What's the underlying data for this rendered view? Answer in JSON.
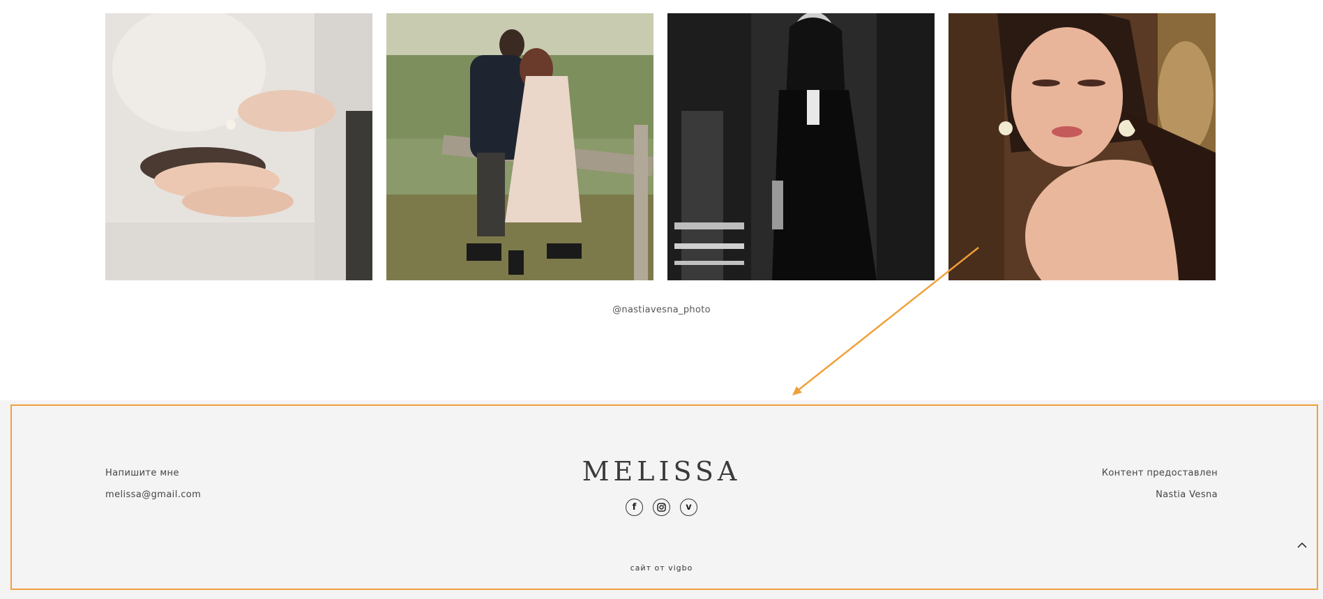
{
  "instagram": {
    "handle": "@nastiavesna_photo",
    "photos": [
      {
        "alt": "hands-embrace-photo"
      },
      {
        "alt": "couple-in-field-photo"
      },
      {
        "alt": "woman-black-dress-photo"
      },
      {
        "alt": "woman-earrings-portrait-photo"
      }
    ]
  },
  "footer": {
    "contact_label": "Напишите мне",
    "email": "melissa@gmail.com",
    "brand": "MELISSA",
    "content_label": "Контент предоставлен",
    "content_author": "Nastia Vesna",
    "credit": "сайт от vigbo",
    "socials": [
      {
        "icon": "facebook-icon",
        "glyph": "f"
      },
      {
        "icon": "instagram-icon",
        "glyph": "◎"
      },
      {
        "icon": "vimeo-icon",
        "glyph": "v"
      }
    ]
  },
  "colors": {
    "footer_bg": "#f4f4f4",
    "highlight": "#f0a03a"
  }
}
